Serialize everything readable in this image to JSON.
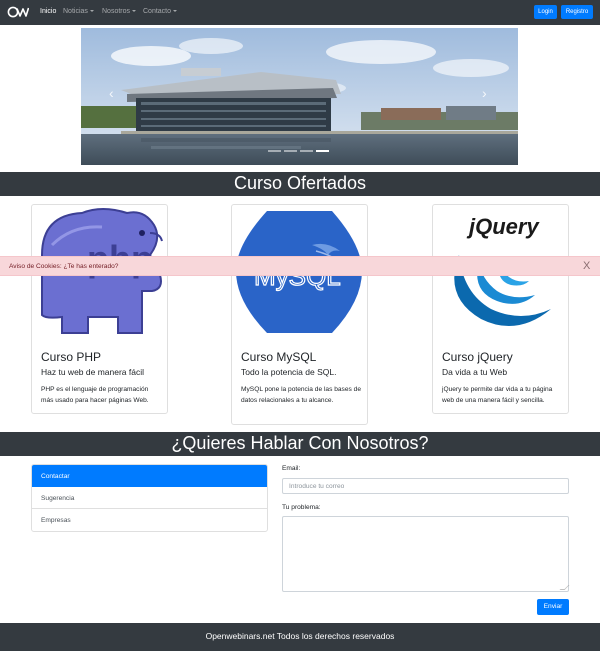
{
  "navbar": {
    "brand_logo": "ow-logo",
    "links": [
      {
        "label": "Inicio",
        "active": true,
        "dropdown": false
      },
      {
        "label": "Noticias",
        "active": false,
        "dropdown": true
      },
      {
        "label": "Nosotros",
        "active": false,
        "dropdown": true
      },
      {
        "label": "Contacto",
        "active": false,
        "dropdown": true
      }
    ],
    "login_label": "Login",
    "register_label": "Registro"
  },
  "carousel": {
    "image": "opera-house-waterfront-photo",
    "prev_icon": "chevron-left-icon",
    "next_icon": "chevron-right-icon",
    "slide_count": 4,
    "active_slide": 4
  },
  "courses": {
    "heading": "Curso Ofertados",
    "cards": [
      {
        "image": "php-elephant-logo",
        "title": "Curso PHP",
        "subtitle": "Haz tu web de manera fácil",
        "text": "PHP es el lenguaje de programación más usado para hacer páginas Web."
      },
      {
        "image": "mysql-dolphin-logo",
        "title": "Curso MySQL",
        "subtitle": "Todo la potencia de SQL.",
        "text": "MySQL pone la potencia de las bases de datos relacionales a tu alcance."
      },
      {
        "image": "jquery-logo",
        "title": "Curso jQuery",
        "subtitle": "Da vida a tu Web",
        "text": "jQuery te permite dar vida a tu página web de una manera fácil y sencilla."
      }
    ],
    "logo_text": {
      "php": "php",
      "mysql": "MySQL",
      "jquery": "jQuery"
    }
  },
  "cookie_alert": {
    "text": "Aviso de Cookies: ¿Te has enterado?",
    "close_label": "X"
  },
  "contact": {
    "heading": "¿Quieres Hablar Con Nosotros?",
    "tabs": [
      "Contactar",
      "Sugerencia",
      "Empresas"
    ],
    "email_label": "Email:",
    "email_placeholder": "Introduce tu correo",
    "problem_label": "Tu problema:",
    "submit_label": "Enviar"
  },
  "footer": {
    "text": "Openwebinars.net Todos los derechos reservados"
  },
  "colors": {
    "navbar_bg": "#343a40",
    "primary": "#007bff",
    "alert_bg": "#f8d7da",
    "alert_text": "#721c24"
  }
}
